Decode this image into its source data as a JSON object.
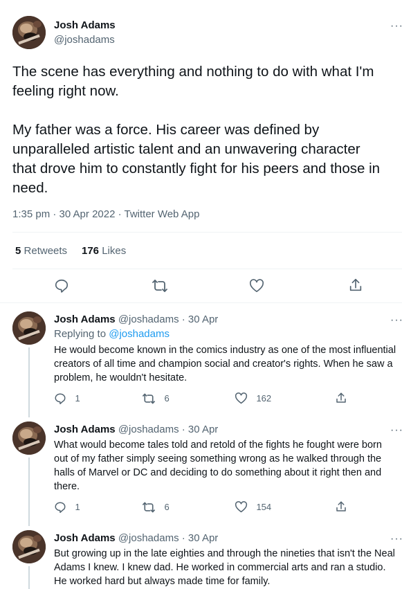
{
  "main_tweet": {
    "author_name": "Josh Adams",
    "author_handle": "@joshadams",
    "more": "···",
    "paragraph1": "The scene has everything and nothing to do with what I'm feeling right now.",
    "paragraph2": "My father was a force. His career was defined by unparalleled artistic talent and an unwavering character that drove him to constantly fight for his peers and those in need.",
    "timestamp": "1:35 pm · 30 Apr 2022 · Twitter Web App",
    "retweets_count": "5",
    "retweets_label": "Retweets",
    "likes_count": "176",
    "likes_label": "Likes"
  },
  "replies": [
    {
      "author_name": "Josh Adams",
      "author_handle": "@joshadams",
      "date": "· 30 Apr",
      "replying_prefix": "Replying to",
      "replying_to": "@joshadams",
      "text": "He would become known in the comics industry as one of the most influential creators of all time and champion social and creator's rights. When he saw a problem, he wouldn't hesitate.",
      "reply_count": "1",
      "retweet_count": "6",
      "like_count": "162"
    },
    {
      "author_name": "Josh Adams",
      "author_handle": "@joshadams",
      "date": "· 30 Apr",
      "text": "What would become tales told and retold of the fights he fought were born out of my father simply seeing something wrong as he walked through the halls of Marvel or DC and deciding to do something about it right then and there.",
      "reply_count": "1",
      "retweet_count": "6",
      "like_count": "154"
    },
    {
      "author_name": "Josh Adams",
      "author_handle": "@joshadams",
      "date": "· 30 Apr",
      "text": "But growing up in the late eighties and through the nineties that isn't the Neal Adams I knew. I knew dad. He worked in commercial arts and ran a studio. He worked hard but always made time for family."
    }
  ],
  "icons": {
    "reply": "reply-icon",
    "retweet": "retweet-icon",
    "like": "heart-icon",
    "share": "share-icon",
    "more": "more-icon"
  },
  "colors": {
    "link": "#1d9bf0",
    "secondary_text": "#536471",
    "divider": "#eff3f4"
  }
}
